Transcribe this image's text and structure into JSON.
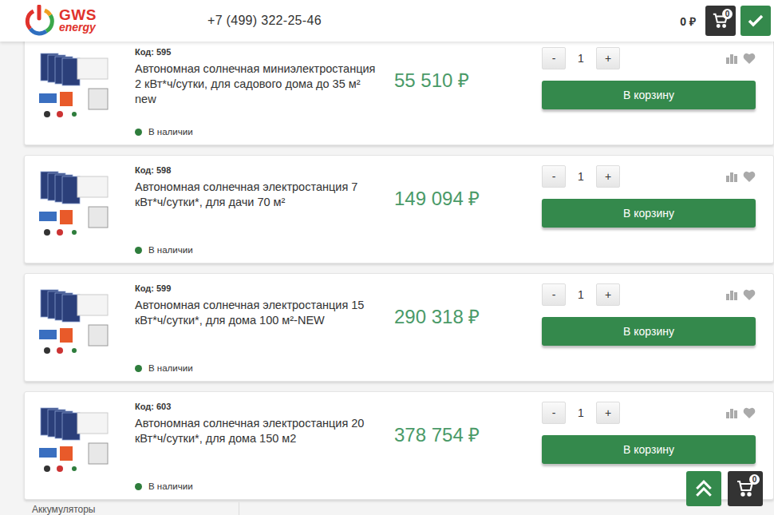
{
  "header": {
    "logo": {
      "line1": "GWS",
      "line2": "energy"
    },
    "phone": "+7 (499) 322-25-46",
    "cart_total": "0 ₽",
    "cart_count": "0"
  },
  "products": [
    {
      "code": "Код: 595",
      "title": "Автономная солнечная миниэлектростанция 2 кВт*ч/сутки, для садового дома до 35 м² new",
      "price": "55 510 ₽",
      "stock": "В наличии",
      "in_stock": true,
      "quantity": "1",
      "minus": "-",
      "plus": "+",
      "button": "В корзину"
    },
    {
      "code": "Код: 598",
      "title": "Автономная солнечная электростанция 7 кВт*ч/сутки*, для дачи 70 м²",
      "price": "149 094 ₽",
      "stock": "В наличии",
      "in_stock": true,
      "quantity": "1",
      "minus": "-",
      "plus": "+",
      "button": "В корзину"
    },
    {
      "code": "Код: 599",
      "title": "Автономная солнечная электростанция 15 кВт*ч/сутки*, для дома 100 м²-NEW",
      "price": "290 318 ₽",
      "stock": "В наличии",
      "in_stock": true,
      "quantity": "1",
      "minus": "-",
      "plus": "+",
      "button": "В корзину"
    },
    {
      "code": "Код: 603",
      "title": "Автономная солнечная электростанция 20 кВт*ч/сутки*, для дома 150 м2",
      "price": "378 754 ₽",
      "stock": "В наличии",
      "in_stock": true,
      "quantity": "1",
      "minus": "-",
      "plus": "+",
      "button": "В корзину"
    }
  ],
  "sidebar": {
    "items": [
      "Аккумуляторы"
    ]
  },
  "floating": {
    "cart_count": "0"
  }
}
